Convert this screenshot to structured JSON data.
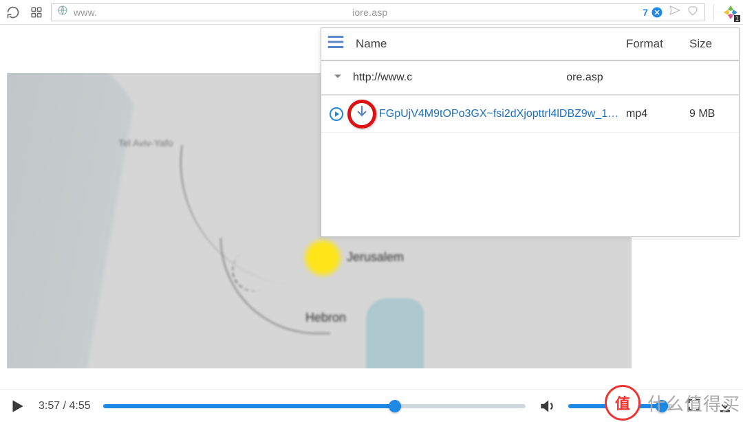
{
  "topbar": {
    "url_prefix": "www.",
    "url_suffix": "iore.asp",
    "badge_count": "7"
  },
  "panel": {
    "head": {
      "name": "Name",
      "format": "Format",
      "size": "Size"
    },
    "group": {
      "prefix": "http://www.c",
      "suffix": "ore.asp"
    },
    "item": {
      "filename": "FGpUjV4M9tOPo3GX~fsi2dXjopttrl4lDBZ9w_16_...",
      "format": "mp4",
      "size": "9 MB"
    }
  },
  "map": {
    "jerusalem": "Jerusalem",
    "hebron": "Hebron",
    "telaviv": "Tel Aviv-Yafo"
  },
  "player": {
    "current": "3:57",
    "sep": " / ",
    "total": "4:55",
    "progress_pct": 69,
    "volume_pct": 88
  },
  "watermark": {
    "badge": "值",
    "text": "什么值得买"
  },
  "extension": {
    "count": "1"
  }
}
